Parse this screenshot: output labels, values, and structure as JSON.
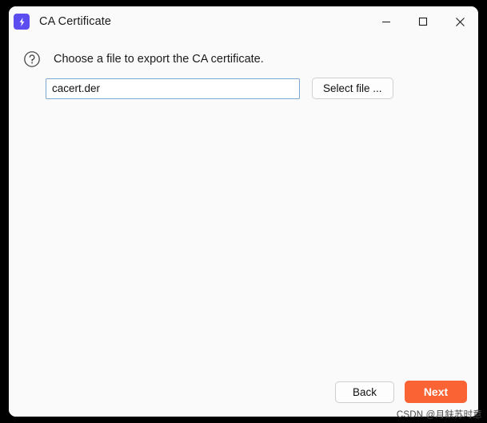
{
  "window": {
    "title": "CA Certificate",
    "app_icon": "lightning-bolt-icon",
    "accent_color": "#5b4df0",
    "controls": {
      "minimize": "minimize-icon",
      "maximize": "maximize-icon",
      "close": "close-icon"
    }
  },
  "content": {
    "help_icon": "question-mark-circle-icon",
    "prompt": "Choose a file to export the CA certificate.",
    "file_field": {
      "value": "cacert.der",
      "placeholder": "",
      "focused": true
    },
    "select_file_label": "Select file ..."
  },
  "footer": {
    "back_label": "Back",
    "next_label": "Next",
    "next_color": "#fa6434"
  },
  "watermark": {
    "text": "CSDN @月鈇苏时意"
  }
}
